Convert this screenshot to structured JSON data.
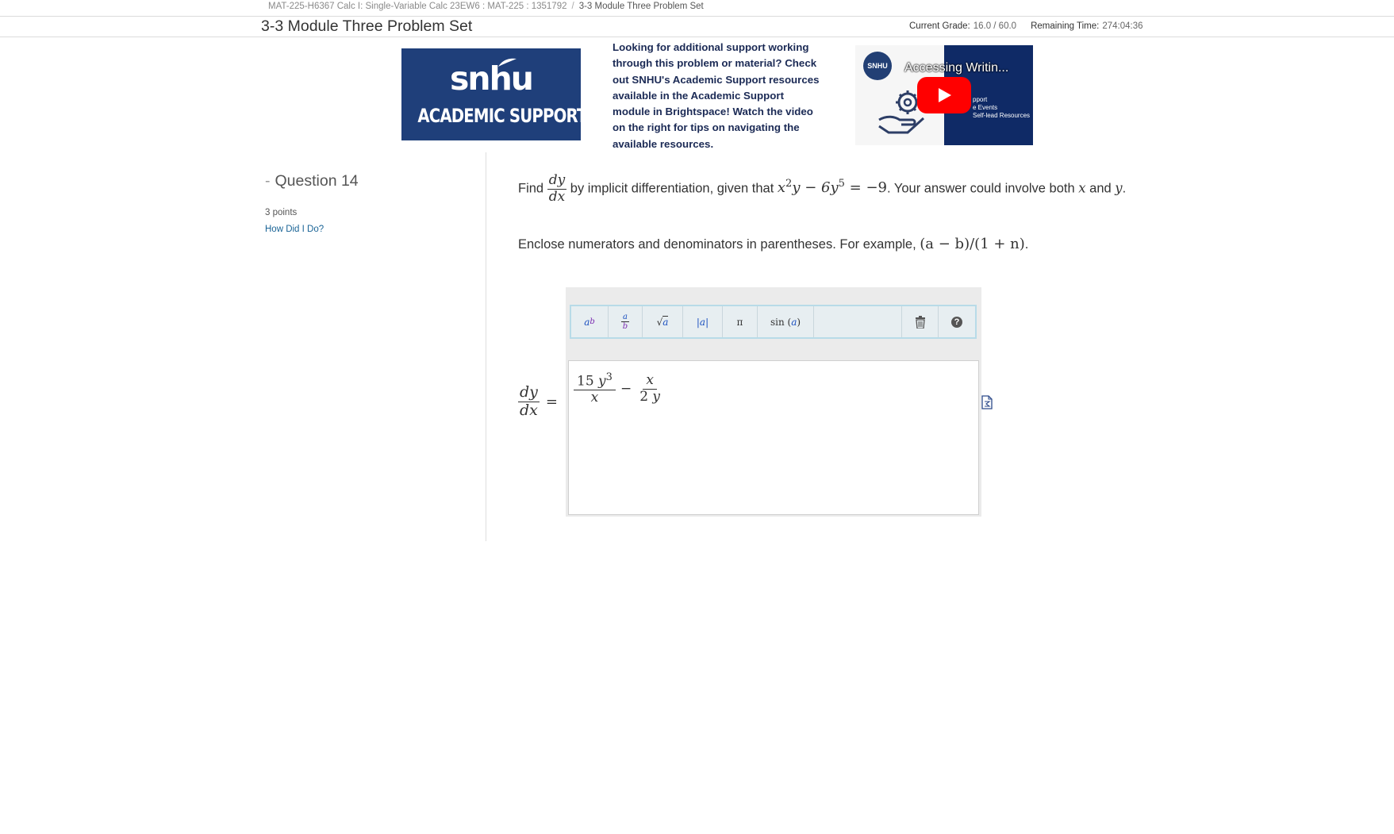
{
  "breadcrumb": {
    "course": "MAT-225-H6367 Calc I: Single-Variable Calc 23EW6 : MAT-225 : 1351792",
    "separator": "/",
    "current": "3-3 Module Three Problem Set"
  },
  "header": {
    "title": "3-3 Module Three Problem Set",
    "grade_label": "Current Grade:",
    "grade_value": "16.0 / 60.0",
    "time_label": "Remaining Time:",
    "time_value": "274:04:36"
  },
  "banner": {
    "wordmark": "snhu",
    "subtitle": "ACADEMIC SUPPORT",
    "brand_color": "#1f3f7a"
  },
  "support": {
    "text": "Looking for additional support working through this problem or material? Check out SNHU's Academic Support resources available in the Academic Support module in Brightspace! Watch the video on the right for tips on navigating the available resources."
  },
  "video": {
    "channel": "SNHU",
    "title": "Accessing Writin...",
    "list": [
      "pport",
      "e Events",
      "Self-lead Resources"
    ],
    "play_color": "#ff0000"
  },
  "question": {
    "dash": "-",
    "label": "Question 14",
    "points": "3 points",
    "how_did_i_do": "How Did I Do?"
  },
  "problem": {
    "find": "Find",
    "dy": "dy",
    "dx": "dx",
    "text_mid": "by implicit differentiation, given that",
    "eq_x": "x",
    "eq_exp1": "2",
    "eq_y": "y − 6y",
    "eq_exp2": "5",
    "eq_rhs": " = −9",
    "text_end_a": ". Your answer could involve both",
    "var_x": "x",
    "and": "and",
    "var_y": "y",
    "period": "."
  },
  "instruction": {
    "text": "Enclose numerators and denominators in parentheses. For example,",
    "example": "(a − b)/(1 + n)",
    "period": "."
  },
  "toolbar": {
    "power_base": "a",
    "power_exp": "b",
    "frac_num": "a",
    "frac_den": "b",
    "sqrt": "√",
    "sqrt_arg": "a",
    "abs_bar": "|",
    "abs_arg": "a",
    "pi": "π",
    "sin": "sin",
    "sin_arg": "a",
    "trash_icon": "trash-icon",
    "help_icon": "?"
  },
  "answer": {
    "lhs_num": "dy",
    "lhs_den": "dx",
    "equals": "=",
    "term1_num_coeff": "15",
    "term1_num_var": "y",
    "term1_num_exp": "3",
    "term1_den": "x",
    "minus": "−",
    "term2_num": "x",
    "term2_den_coeff": "2",
    "term2_den_var": "y"
  }
}
